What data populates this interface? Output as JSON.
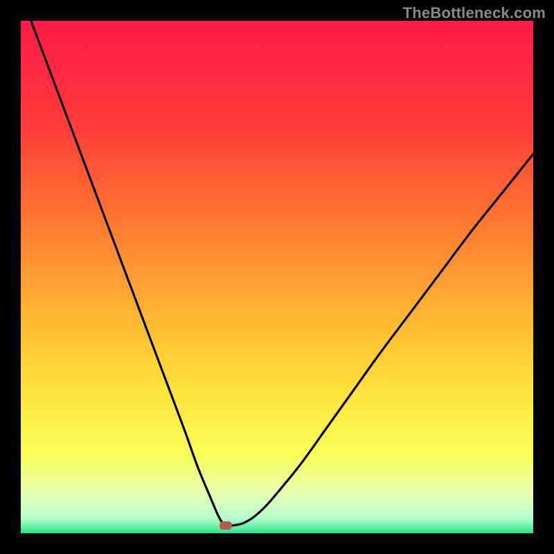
{
  "watermark": "TheBottleneck.com",
  "chart_data": {
    "type": "line",
    "title": "",
    "xlabel": "",
    "ylabel": "",
    "xlim": [
      0,
      100
    ],
    "ylim": [
      0,
      100
    ],
    "min_marker": {
      "x": 40,
      "y": 1.5
    },
    "gradient_stops": [
      {
        "offset": 0.0,
        "color": "#ff1a49"
      },
      {
        "offset": 0.2,
        "color": "#ff3b3b"
      },
      {
        "offset": 0.4,
        "color": "#ff7a2f"
      },
      {
        "offset": 0.58,
        "color": "#ffb733"
      },
      {
        "offset": 0.72,
        "color": "#ffe23a"
      },
      {
        "offset": 0.85,
        "color": "#f7ff5a"
      },
      {
        "offset": 0.92,
        "color": "#e8ffb0"
      },
      {
        "offset": 0.97,
        "color": "#b6ffd0"
      },
      {
        "offset": 1.0,
        "color": "#29e58a"
      }
    ],
    "series": [
      {
        "name": "curve",
        "x": [
          2,
          5,
          8,
          11,
          14,
          17,
          20,
          23,
          26,
          29,
          32,
          34.5,
          37,
          38.5,
          39.5,
          40,
          41,
          42,
          43.5,
          45.5,
          48,
          51,
          55,
          60,
          65,
          70,
          76,
          82,
          88,
          94,
          100
        ],
        "y": [
          100,
          92,
          84,
          76,
          68,
          60,
          52,
          44,
          36,
          28,
          20,
          13,
          7,
          3.5,
          1.8,
          1.5,
          1.5,
          1.6,
          2.0,
          3.2,
          5.5,
          9,
          14,
          21,
          28,
          35,
          43,
          51,
          59,
          66.5,
          74
        ]
      }
    ]
  }
}
